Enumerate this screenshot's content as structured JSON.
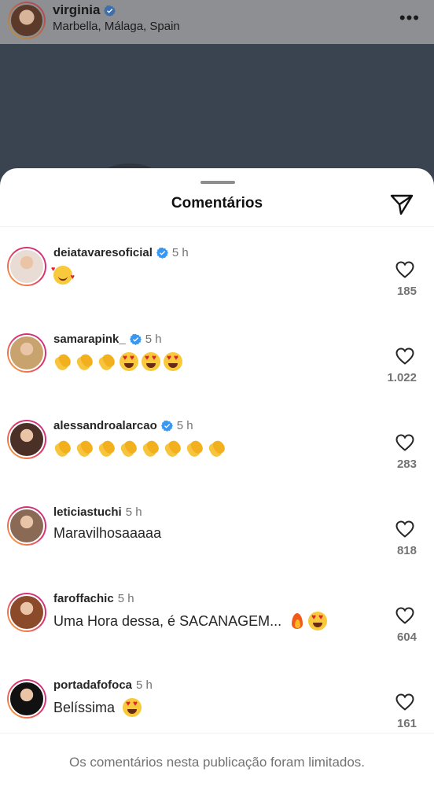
{
  "post": {
    "username": "virginia",
    "location": "Marbella, Málaga, Spain",
    "more_icon": "more-horizontal-icon"
  },
  "sheet": {
    "title": "Comentários",
    "send_icon": "send-paper-plane-icon"
  },
  "comments": [
    {
      "user": "deiatavaresoficial",
      "verified": true,
      "time": "5 h",
      "text": "",
      "emojis": [
        "smiling-face-with-hearts"
      ],
      "likes": "185",
      "avatar_color": "#e8dcd4"
    },
    {
      "user": "samarapink_",
      "verified": true,
      "time": "5 h",
      "text": "",
      "emojis": [
        "clap",
        "clap",
        "clap",
        "heart-eyes",
        "heart-eyes",
        "heart-eyes"
      ],
      "likes": "1.022",
      "avatar_color": "#c9a36e"
    },
    {
      "user": "alessandroalarcao",
      "verified": true,
      "time": "5 h",
      "text": "",
      "emojis": [
        "clap",
        "clap",
        "clap",
        "clap",
        "clap",
        "clap",
        "clap",
        "clap"
      ],
      "likes": "283",
      "avatar_color": "#4a3026"
    },
    {
      "user": "leticiastuchi",
      "verified": false,
      "time": "5 h",
      "text": "Maravilhosaaaaa",
      "emojis": [],
      "likes": "818",
      "avatar_color": "#8a6a55"
    },
    {
      "user": "faroffachic",
      "verified": false,
      "time": "5 h",
      "text": "Uma Hora dessa, é SACANAGEM...",
      "emojis": [
        "fire",
        "heart-eyes"
      ],
      "likes": "604",
      "avatar_color": "#8b4a2a"
    },
    {
      "user": "portadafofoca",
      "verified": false,
      "time": "5 h",
      "text": "Belíssima",
      "emojis": [
        "heart-eyes"
      ],
      "likes": "161",
      "avatar_color": "#111111"
    }
  ],
  "footer": {
    "text": "Os comentários nesta publicação foram limitados."
  },
  "colors": {
    "verified_blue": "#3897f0",
    "muted": "#737373"
  }
}
